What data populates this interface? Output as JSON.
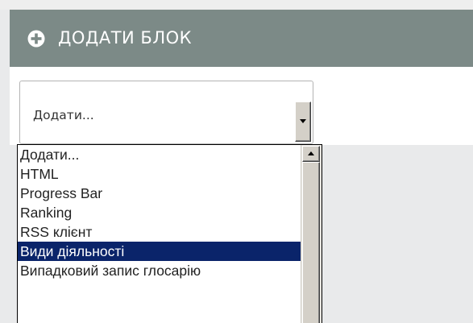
{
  "block_panel": {
    "title": "ДОДАТИ БЛОК",
    "icon": "plus-circle-icon",
    "header_color": "#7c8a87"
  },
  "select": {
    "current_value": "Додати..."
  },
  "dropdown": {
    "options": [
      "Додати...",
      "HTML",
      "Progress Bar",
      "Ranking",
      "RSS клієнт",
      "Види діяльності",
      "Випадковий запис глосарію"
    ],
    "highlighted": "Види діяльності",
    "highlight_color": "#0a246a"
  }
}
